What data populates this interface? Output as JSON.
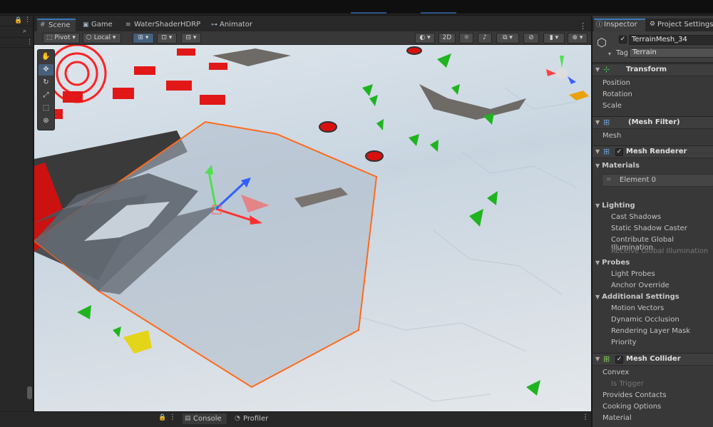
{
  "scene_tabs": [
    {
      "label": "Scene",
      "icon": "hash-icon"
    },
    {
      "label": "Game",
      "icon": "gamepad-icon"
    },
    {
      "label": "WaterShaderHDRP",
      "icon": "layers-icon"
    },
    {
      "label": "Animator",
      "icon": "animator-icon"
    }
  ],
  "toolbar": {
    "pivot": "Pivot",
    "local": "Local",
    "mode_2d": "2D"
  },
  "bottom_tabs": [
    {
      "label": "Console",
      "icon": "console-icon"
    },
    {
      "label": "Profiler",
      "icon": "profiler-icon"
    }
  ],
  "inspector": {
    "tabs": [
      {
        "label": "Inspector",
        "icon": "info-icon"
      },
      {
        "label": "Project Settings",
        "icon": "gear-icon"
      }
    ],
    "object_name": "TerrainMesh_34",
    "tag_label": "Tag",
    "tag_value": "Terrain",
    "transform": {
      "title": "Transform",
      "props": [
        "Position",
        "Rotation",
        "Scale"
      ]
    },
    "mesh_filter": {
      "title": "(Mesh Filter)",
      "props": [
        "Mesh"
      ]
    },
    "mesh_renderer": {
      "title": "Mesh Renderer",
      "materials": "Materials",
      "element": "Element 0",
      "lighting": "Lighting",
      "lighting_props": [
        "Cast Shadows",
        "Static Shadow Caster",
        "Contribute Global Illumination",
        "Receive Global Illumination"
      ],
      "probes": "Probes",
      "probes_props": [
        "Light Probes",
        "Anchor Override"
      ],
      "additional": "Additional Settings",
      "additional_props": [
        "Motion Vectors",
        "Dynamic Occlusion",
        "Rendering Layer Mask",
        "Priority"
      ]
    },
    "mesh_collider": {
      "title": "Mesh Collider",
      "props": [
        "Convex",
        "Is Trigger",
        "Provides Contacts",
        "Cooking Options",
        "Material"
      ]
    }
  }
}
